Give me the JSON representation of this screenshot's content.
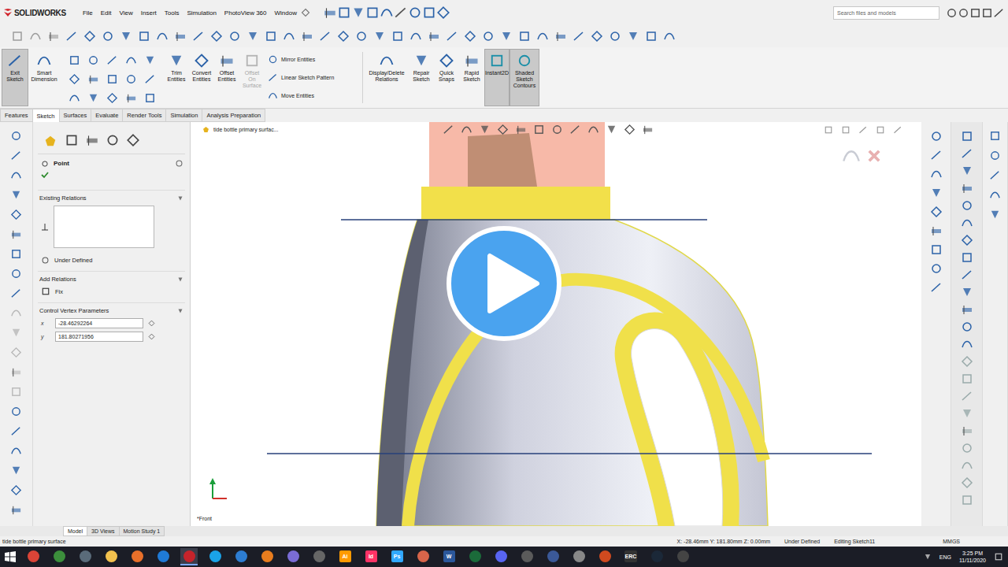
{
  "titlebar": {
    "logo": "SOLIDWORKS",
    "menus": [
      "File",
      "Edit",
      "View",
      "Insert",
      "Tools",
      "Simulation",
      "PhotoView 360",
      "Window"
    ],
    "search": {
      "placeholder": "Search files and models"
    }
  },
  "ribbon": {
    "left": [
      {
        "label": "Exit Sketch",
        "active": true
      },
      {
        "label": "Smart Dimension",
        "active": false
      }
    ],
    "entities": [
      {
        "label": "Trim Entities",
        "disabled": false
      },
      {
        "label": "Convert Entities",
        "disabled": false
      },
      {
        "label": "Offset Entities",
        "disabled": false
      },
      {
        "label": "Offset On Surface",
        "disabled": true
      }
    ],
    "list": [
      "Mirror Entities",
      "Linear Sketch Pattern",
      "Move Entities"
    ],
    "right": [
      {
        "label": "Display/Delete Relations",
        "active": false
      },
      {
        "label": "Repair Sketch",
        "active": false
      },
      {
        "label": "Quick Snaps",
        "active": false
      },
      {
        "label": "Rapid Sketch",
        "active": false
      },
      {
        "label": "Instant2D",
        "active": true
      },
      {
        "label": "Shaded Sketch Contours",
        "active": true
      }
    ]
  },
  "tabs": [
    {
      "label": "Features",
      "selected": false
    },
    {
      "label": "Sketch",
      "selected": true
    },
    {
      "label": "Surfaces",
      "selected": false
    },
    {
      "label": "Evaluate",
      "selected": false
    },
    {
      "label": "Render Tools",
      "selected": false
    },
    {
      "label": "Simulation",
      "selected": false
    },
    {
      "label": "Analysis Preparation",
      "selected": false
    }
  ],
  "property_manager": {
    "title": "Point",
    "existing_relations": {
      "header": "Existing Relations",
      "status": "Under Defined"
    },
    "add_relations": {
      "header": "Add Relations",
      "items": [
        "Fix"
      ]
    },
    "parameters": {
      "header": "Control Vertex Parameters",
      "fields": [
        {
          "axis": "x",
          "value": "-28.46292264"
        },
        {
          "axis": "y",
          "value": "181.80271956"
        }
      ]
    }
  },
  "graphics": {
    "tree_item": "tide bottle primary surfac...",
    "view_label": "*Front",
    "video": {
      "playing": false
    }
  },
  "model_tabs": [
    {
      "label": "Model",
      "selected": true
    },
    {
      "label": "3D Views",
      "selected": false
    },
    {
      "label": "Motion Study 1",
      "selected": false
    }
  ],
  "status_bar": {
    "document": "tide bottle primary surface",
    "coordinates": "X: -28.46mm Y: 181.80mm Z: 0.00mm",
    "state": "Under Defined",
    "mode": "Editing Sketch11",
    "units": "MMGS"
  },
  "taskbar": {
    "apps": [
      {
        "kind": "dot",
        "color": "#db4437",
        "active": false
      },
      {
        "kind": "dot",
        "color": "#3c8f3c",
        "active": false
      },
      {
        "kind": "dot",
        "color": "#5a6b7a",
        "active": false
      },
      {
        "kind": "dot",
        "color": "#f2c14e",
        "active": false
      },
      {
        "kind": "dot",
        "color": "#e8702a",
        "active": false
      },
      {
        "kind": "dot",
        "color": "#1f7ad6",
        "active": false
      },
      {
        "kind": "dot",
        "color": "#c5232b",
        "active": true
      },
      {
        "kind": "dot",
        "color": "#1aa3e8",
        "active": false
      },
      {
        "kind": "dot",
        "color": "#2d7dd2",
        "active": false
      },
      {
        "kind": "dot",
        "color": "#e87d1e",
        "active": false
      },
      {
        "kind": "dot",
        "color": "#7a6cd6",
        "active": false
      },
      {
        "kind": "dot",
        "color": "#666666",
        "active": false
      },
      {
        "kind": "text",
        "label": "Ai",
        "color": "#ff9a00",
        "active": false
      },
      {
        "kind": "text",
        "label": "Id",
        "color": "#ff3366",
        "active": false
      },
      {
        "kind": "text",
        "label": "Ps",
        "color": "#31a8ff",
        "active": false
      },
      {
        "kind": "dot",
        "color": "#d8654a",
        "active": false
      },
      {
        "kind": "text",
        "label": "W",
        "color": "#2b579a",
        "active": false
      },
      {
        "kind": "dot",
        "color": "#1b6b3a",
        "active": false
      },
      {
        "kind": "dot",
        "color": "#5865f2",
        "active": false
      },
      {
        "kind": "dot",
        "color": "#5b5b5b",
        "active": false
      },
      {
        "kind": "dot",
        "color": "#3b5998",
        "active": false
      },
      {
        "kind": "dot",
        "color": "#888888",
        "active": false
      },
      {
        "kind": "dot",
        "color": "#d04a1f",
        "active": false
      },
      {
        "kind": "text",
        "label": "ERC",
        "color": "#333333",
        "active": false
      },
      {
        "kind": "dot",
        "color": "#1b2838",
        "active": false
      },
      {
        "kind": "dot",
        "color": "#444444",
        "active": false
      }
    ],
    "language": "ENG",
    "time": "3:25 PM",
    "date": "11/11/2020"
  }
}
